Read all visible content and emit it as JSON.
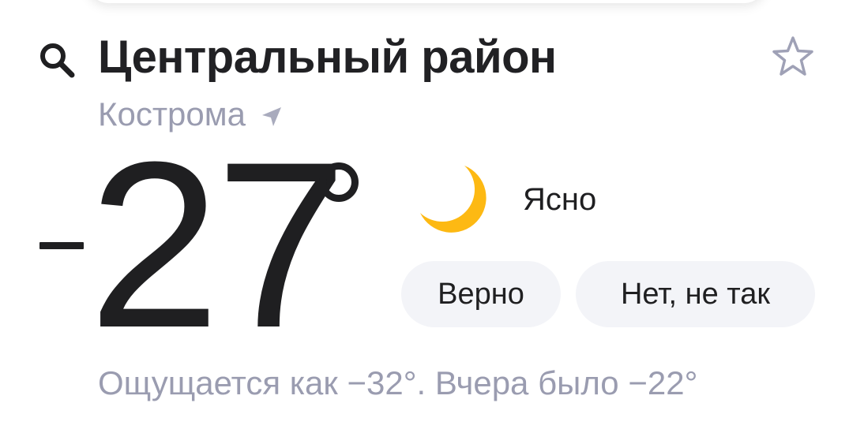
{
  "header": {
    "district": "Центральный район",
    "search_icon": "search-icon",
    "favorite_icon": "star-icon"
  },
  "location": {
    "city": "Кострома",
    "location_icon": "location-arrow-icon"
  },
  "weather": {
    "temperature_sign": "−",
    "temperature_value": "27",
    "degree_symbol": "°",
    "condition": "Ясно",
    "condition_icon": "moon-icon",
    "feels_like_text": "Ощущается как −32°. Вчера было −22°"
  },
  "feedback": {
    "correct_label": "Верно",
    "incorrect_label": "Нет, не так"
  },
  "colors": {
    "text_primary": "#1f1f21",
    "text_secondary": "#9a9cb0",
    "button_bg": "#f3f4f8",
    "moon": "#fdb913",
    "icon_outline": "#9fa1b6"
  }
}
